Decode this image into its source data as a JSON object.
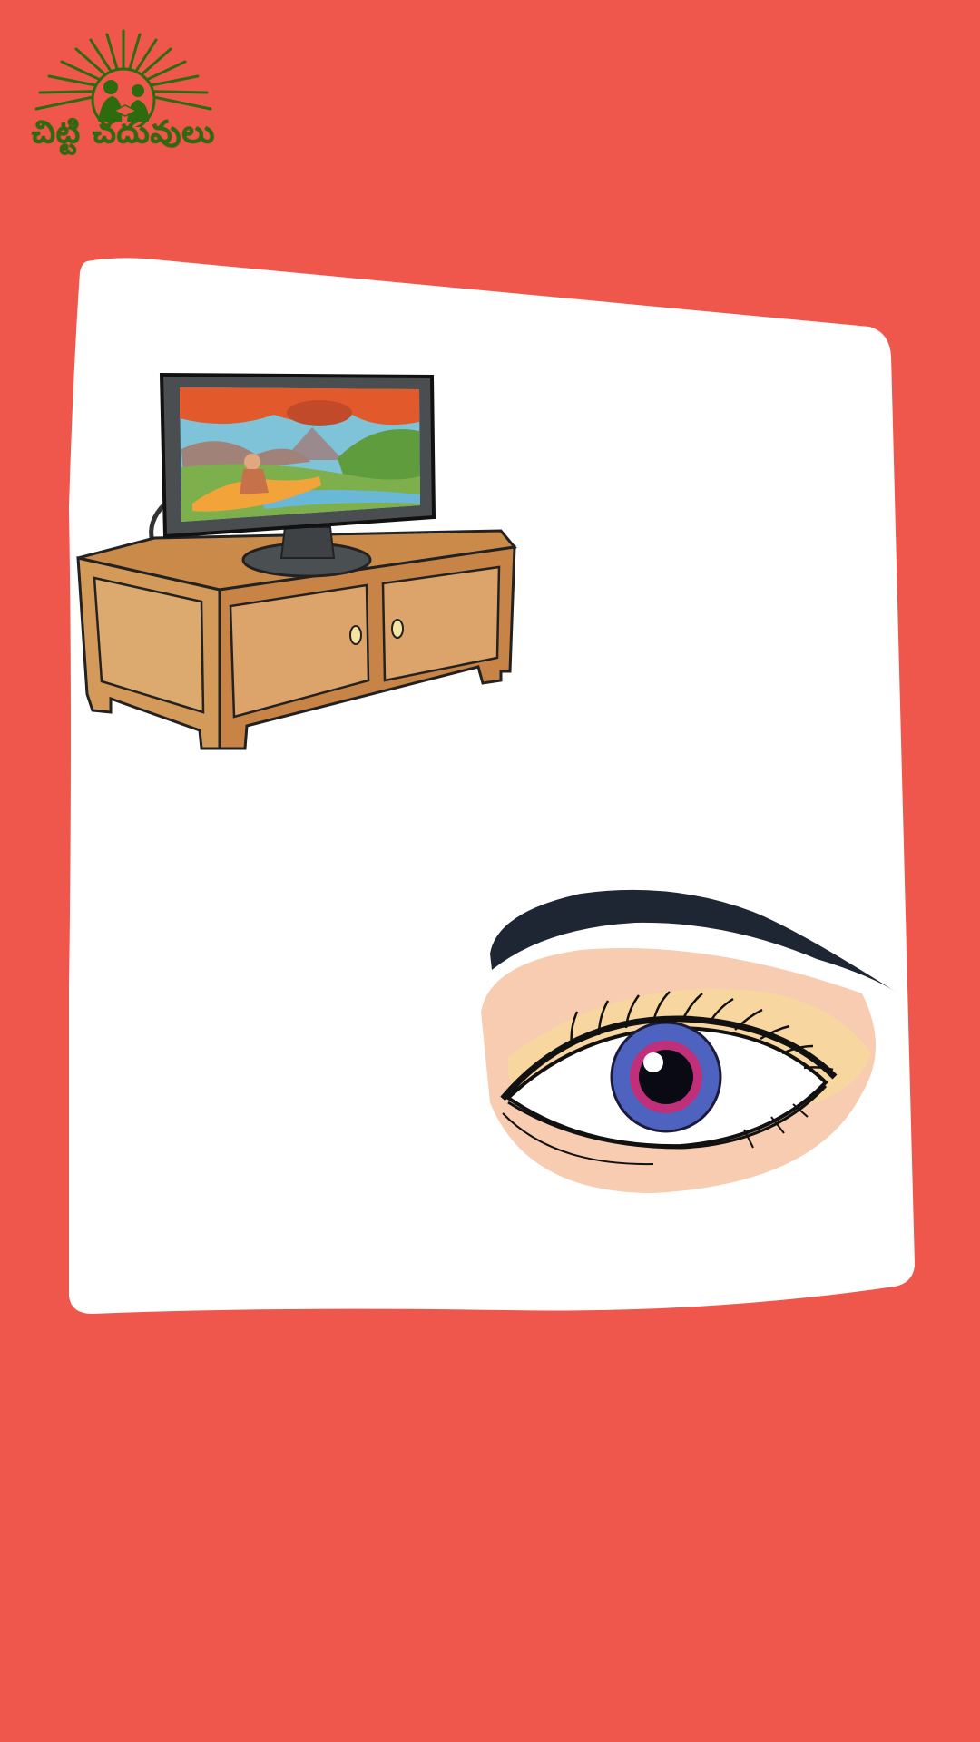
{
  "brand": {
    "logo_text": "చిట్టి చదువులు",
    "colors": {
      "background": "#EF574C",
      "card": "#FFFFFF",
      "logo_green": "#2E6B0E"
    }
  },
  "illustrations": {
    "tv": {
      "icon": "television-on-cabinet-illustration"
    },
    "eye": {
      "icon": "human-eye-illustration"
    }
  }
}
